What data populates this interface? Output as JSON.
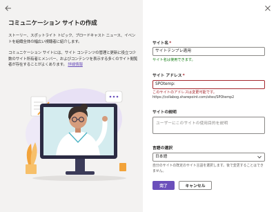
{
  "panel": {
    "title": "コミュニケーション サイトの作成",
    "description1": "ストーリー、スポットライト トピック、ブロードキャスト ニュース、イベントを組織全体の幅広い視聴者に紹介します。",
    "description2": "コミュニケーション サイトには、サイト コンテンツの管理と更新に役立つ少数のサイト所有者とメンバー、およびコンテンツを表示する多くのサイト閲覧者が存在することがよくあります。",
    "learn_more": "詳細情報"
  },
  "form": {
    "site_name": {
      "label": "サイト名",
      "required_mark": "*",
      "value": "サイトテンプレ適用",
      "message": "サイト名は使用できます。"
    },
    "site_address": {
      "label": "サイト アドレス",
      "required_mark": "*",
      "value": "SPOtemp:",
      "error": "このサイトのアドレスは変更可能です。",
      "url": "https://collabog.sharepoint.com/sites/SPOtemp2"
    },
    "site_description": {
      "label": "サイトの説明",
      "placeholder": "ユーザーにこのサイトの使用目的を説明"
    },
    "language": {
      "label": "言語の選択",
      "selected": "日本語",
      "help": "自分のサイトの既定のサイト言語を選択します。後で変更することはできません。"
    }
  },
  "buttons": {
    "finish": "完了",
    "cancel": "キャンセル"
  },
  "icons": {
    "back": "back-arrow-icon",
    "close": "close-icon",
    "dropdown": "chevron-down-icon"
  },
  "colors": {
    "accent": "#6b4fbb",
    "error": "#a4262c",
    "success": "#107c10",
    "panel_bg": "#f3f2f1"
  }
}
